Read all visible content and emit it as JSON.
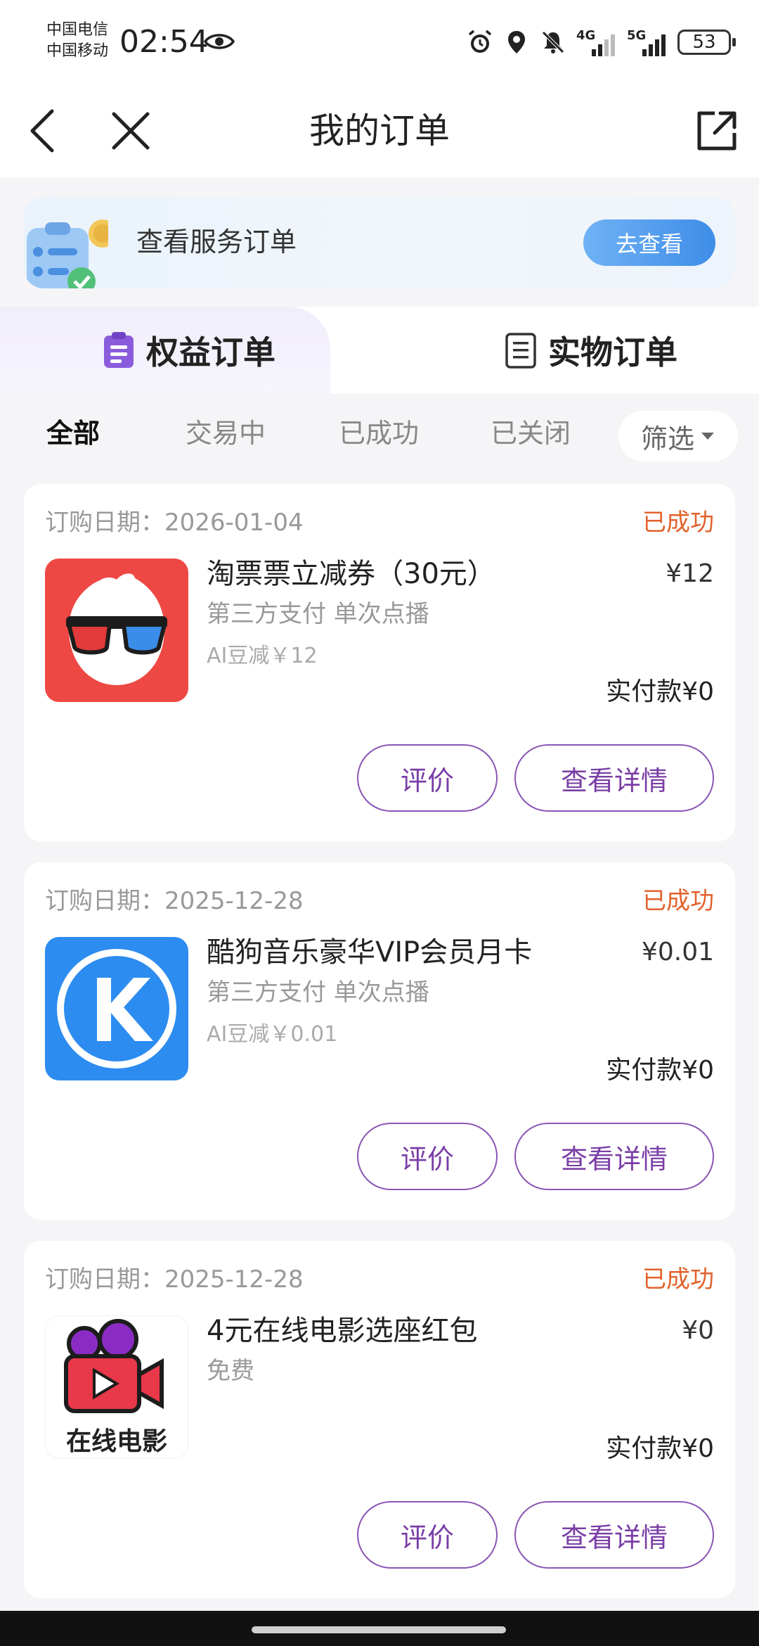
{
  "status_bar": {
    "carrier_1": "中国电信",
    "carrier_2": "中国移动",
    "time": "02:54",
    "net_1": "4G",
    "net_2": "5G",
    "battery": "53"
  },
  "header": {
    "title": "我的订单"
  },
  "banner": {
    "text": "查看服务订单",
    "button": "去查看"
  },
  "order_types": [
    {
      "label": "权益订单",
      "active": true,
      "icon": "clipboard-icon"
    },
    {
      "label": "实物订单",
      "active": false,
      "icon": "document-icon"
    }
  ],
  "filters": {
    "tabs": [
      "全部",
      "交易中",
      "已成功",
      "已关闭"
    ],
    "active_index": 0,
    "screen_label": "筛选"
  },
  "orders": [
    {
      "date": "订购日期：2026-01-04",
      "status": "已成功",
      "name": "淘票票立减券（30元）",
      "price": "¥12",
      "sub": "第三方支付 单次点播",
      "ai": "AI豆减￥12",
      "paid": "实付款¥0",
      "rate": "评价",
      "detail": "查看详情",
      "icon": "taopiaopiao-icon"
    },
    {
      "date": "订购日期：2025-12-28",
      "status": "已成功",
      "name": "酷狗音乐豪华VIP会员月卡",
      "price": "¥0.01",
      "sub": "第三方支付 单次点播",
      "ai": "AI豆减￥0.01",
      "paid": "实付款¥0",
      "rate": "评价",
      "detail": "查看详情",
      "icon": "kugou-icon"
    },
    {
      "date": "订购日期：2025-12-28",
      "status": "已成功",
      "name": "4元在线电影选座红包",
      "price": "¥0",
      "sub": "免费",
      "paid": "实付款¥0",
      "rate": "评价",
      "detail": "查看详情",
      "icon": "online-movie-icon",
      "thumb_caption": "在线电影"
    }
  ],
  "colors": {
    "status_success": "#e2622c",
    "accent_purple": "#7a3ea6",
    "banner_button": "#3f8de8"
  }
}
